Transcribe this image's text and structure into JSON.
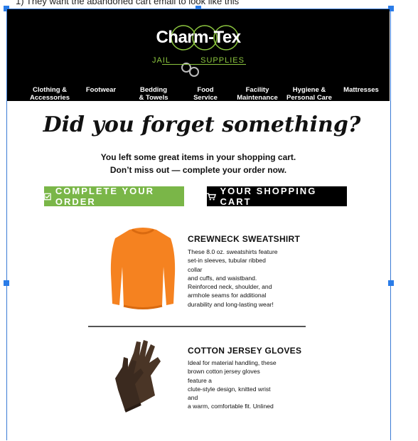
{
  "caption": "1)    They want the abandoned cart email to look like this",
  "brand": {
    "name": "Charm-Tex",
    "sub_left": "JAIL",
    "sub_right": "SUPPLIES",
    "accent": "#8cc63f"
  },
  "nav": [
    {
      "line1": "Clothing &",
      "line2": "Accessories"
    },
    {
      "line1": "Footwear",
      "line2": ""
    },
    {
      "line1": "Bedding",
      "line2": "& Towels"
    },
    {
      "line1": "Food",
      "line2": "Service"
    },
    {
      "line1": "Facility",
      "line2": "Maintenance"
    },
    {
      "line1": "Hygiene &",
      "line2": "Personal Care"
    },
    {
      "line1": "Mattresses",
      "line2": ""
    }
  ],
  "headline": "Did you forget something?",
  "subtext": {
    "line1": "You left some great items in your shopping cart.",
    "line2": "Don’t miss out — complete your order now."
  },
  "buttons": {
    "complete": "COMPLETE YOUR ORDER",
    "cart": "YOUR SHOPPING CART",
    "complete_color": "#7ab648"
  },
  "products": [
    {
      "title": "CREWNECK SWEATSHIRT",
      "desc": [
        "These 8.0 oz. sweatshirts feature",
        "set-in sleeves, tubular ribbed collar",
        "and cuffs, and waistband.",
        "Reinforced neck, shoulder, and",
        "armhole seams for additional",
        "durability and long-lasting wear!"
      ]
    },
    {
      "title": "COTTON JERSEY GLOVES",
      "desc": [
        "Ideal for material handling, these",
        "brown cotton jersey gloves feature a",
        "clute-style design, knitted wrist and",
        "a warm, comfortable fit. Unlined"
      ]
    }
  ]
}
